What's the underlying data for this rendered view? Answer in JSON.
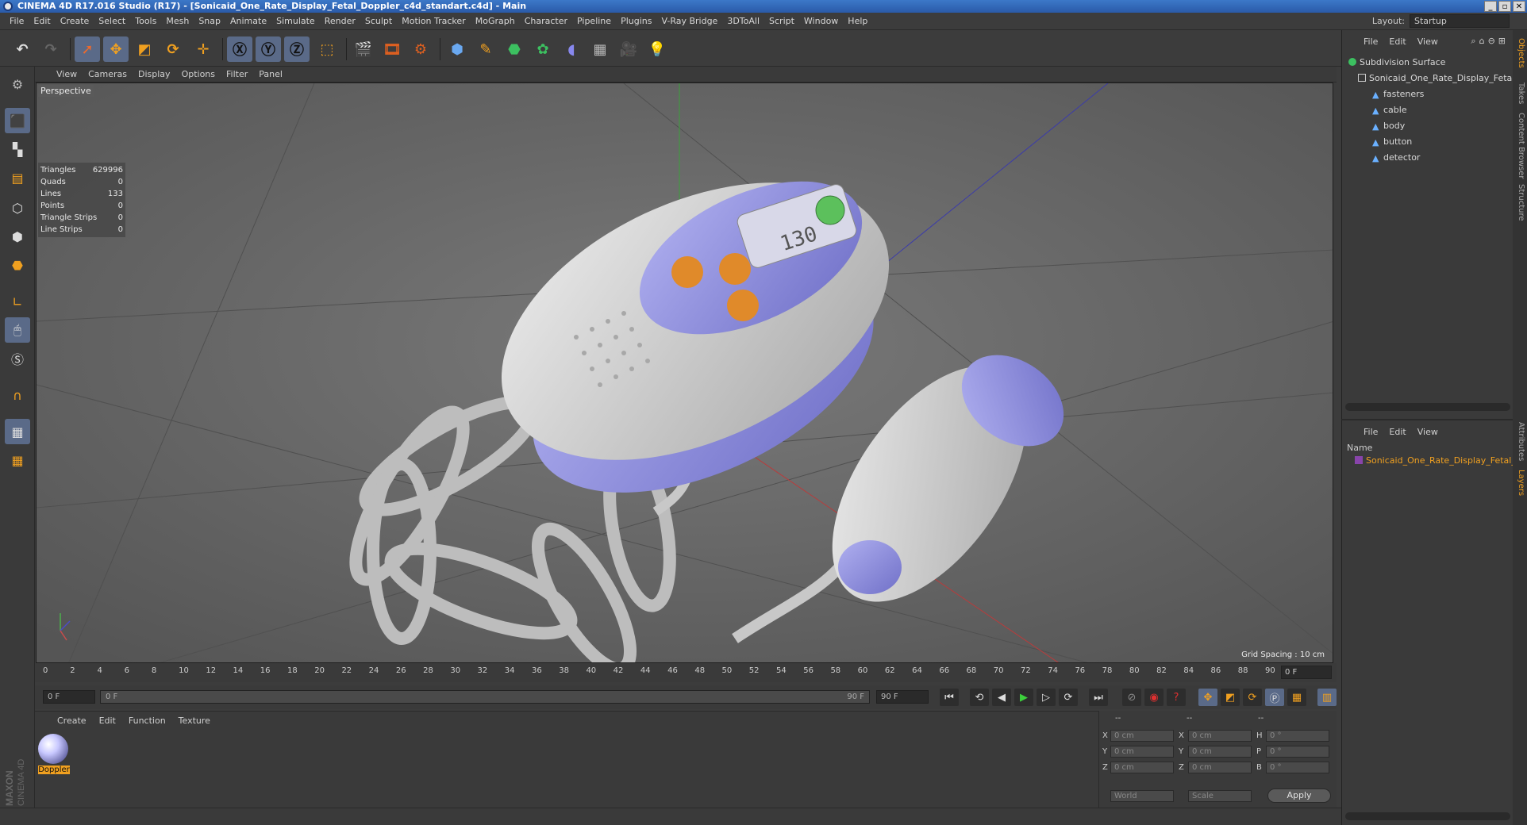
{
  "window": {
    "title": "CINEMA 4D R17.016 Studio (R17) - [Sonicaid_One_Rate_Display_Fetal_Doppler_c4d_standart.c4d] - Main"
  },
  "menu": [
    "File",
    "Edit",
    "Create",
    "Select",
    "Tools",
    "Mesh",
    "Snap",
    "Animate",
    "Simulate",
    "Render",
    "Sculpt",
    "Motion Tracker",
    "MoGraph",
    "Character",
    "Pipeline",
    "Plugins",
    "V-Ray Bridge",
    "3DToAll",
    "Script",
    "Window",
    "Help"
  ],
  "layout": {
    "label": "Layout:",
    "value": "Startup"
  },
  "viewport": {
    "menu": [
      "View",
      "Cameras",
      "Display",
      "Options",
      "Filter",
      "Panel"
    ],
    "label": "Perspective",
    "grid_spacing": "Grid Spacing : 10 cm",
    "stats": [
      {
        "name": "Triangles",
        "value": "629996"
      },
      {
        "name": "Quads",
        "value": "0"
      },
      {
        "name": "Lines",
        "value": "133"
      },
      {
        "name": "Points",
        "value": "0"
      },
      {
        "name": "Triangle Strips",
        "value": "0"
      },
      {
        "name": "Line Strips",
        "value": "0"
      }
    ],
    "display_digits": "130"
  },
  "timeline": {
    "ticks": [
      "0",
      "2",
      "4",
      "6",
      "8",
      "10",
      "12",
      "14",
      "16",
      "18",
      "20",
      "22",
      "24",
      "26",
      "28",
      "30",
      "32",
      "34",
      "36",
      "38",
      "40",
      "42",
      "44",
      "46",
      "48",
      "50",
      "52",
      "54",
      "56",
      "58",
      "60",
      "62",
      "64",
      "66",
      "68",
      "70",
      "72",
      "74",
      "76",
      "78",
      "80",
      "82",
      "84",
      "86",
      "88",
      "90"
    ],
    "end_label": "0 F",
    "start_field": "0 F",
    "slider_start": "0 F",
    "slider_end": "90 F",
    "end_field": "90 F"
  },
  "material": {
    "menu": [
      "Create",
      "Edit",
      "Function",
      "Texture"
    ],
    "name": "Doppler"
  },
  "coords": {
    "headers": [
      "--",
      "--",
      "--"
    ],
    "rows": [
      {
        "a": "X",
        "av": "0 cm",
        "b": "X",
        "bv": "0 cm",
        "c": "H",
        "cv": "0 °"
      },
      {
        "a": "Y",
        "av": "0 cm",
        "b": "Y",
        "bv": "0 cm",
        "c": "P",
        "cv": "0 °"
      },
      {
        "a": "Z",
        "av": "0 cm",
        "b": "Z",
        "bv": "0 cm",
        "c": "B",
        "cv": "0 °"
      }
    ],
    "space": "World",
    "mode": "Scale",
    "apply": "Apply"
  },
  "objects": {
    "menu": [
      "File",
      "Edit",
      "View"
    ],
    "tree": [
      {
        "name": "Subdivision Surface",
        "level": 0
      },
      {
        "name": "Sonicaid_One_Rate_Display_Fetal_",
        "level": 1
      },
      {
        "name": "fasteners",
        "level": 2
      },
      {
        "name": "cable",
        "level": 2
      },
      {
        "name": "body",
        "level": 2
      },
      {
        "name": "button",
        "level": 2
      },
      {
        "name": "detector",
        "level": 2
      }
    ]
  },
  "layers": {
    "menu": [
      "File",
      "Edit",
      "View"
    ],
    "header": "Name",
    "item": "Sonicaid_One_Rate_Display_Fetal_D"
  },
  "side_tabs": [
    "Objects",
    "Takes",
    "Content Browser",
    "Structure",
    "Attributes",
    "Layers"
  ],
  "brand": [
    "MAXON",
    "CINEMA 4D"
  ],
  "colors": {
    "accent": "#f0a020",
    "model_purple": "#8c8ce0",
    "model_body": "#d0d0d0",
    "viewport_bg": "#6b6b6b"
  }
}
